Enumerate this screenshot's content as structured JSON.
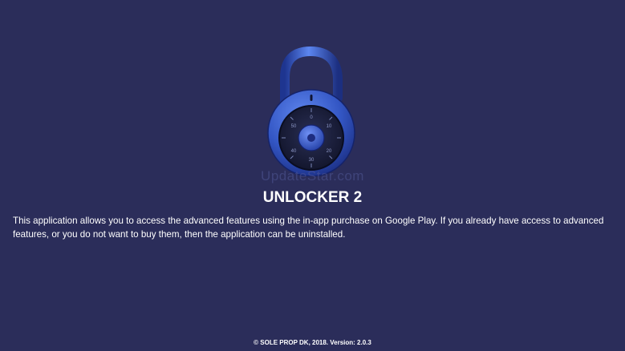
{
  "app": {
    "title": "UNLOCKER 2",
    "watermark": "UpdateStar.com",
    "description": "This application allows you to access the advanced features using the in-app purchase on Google Play. If you already have access to advanced features, or you do not want to buy them, then the application can be uninstalled.",
    "footer": "© SOLE PROP DK, 2018. Version: 2.0.3"
  },
  "lock": {
    "icon": "padlock-icon",
    "dial_numbers": [
      "0",
      "10",
      "20",
      "30",
      "40",
      "50"
    ]
  },
  "colors": {
    "background": "#2b2d5a",
    "lock_blue": "#3a5fd0",
    "dial": "#1b1f3a",
    "text": "#ffffff"
  }
}
